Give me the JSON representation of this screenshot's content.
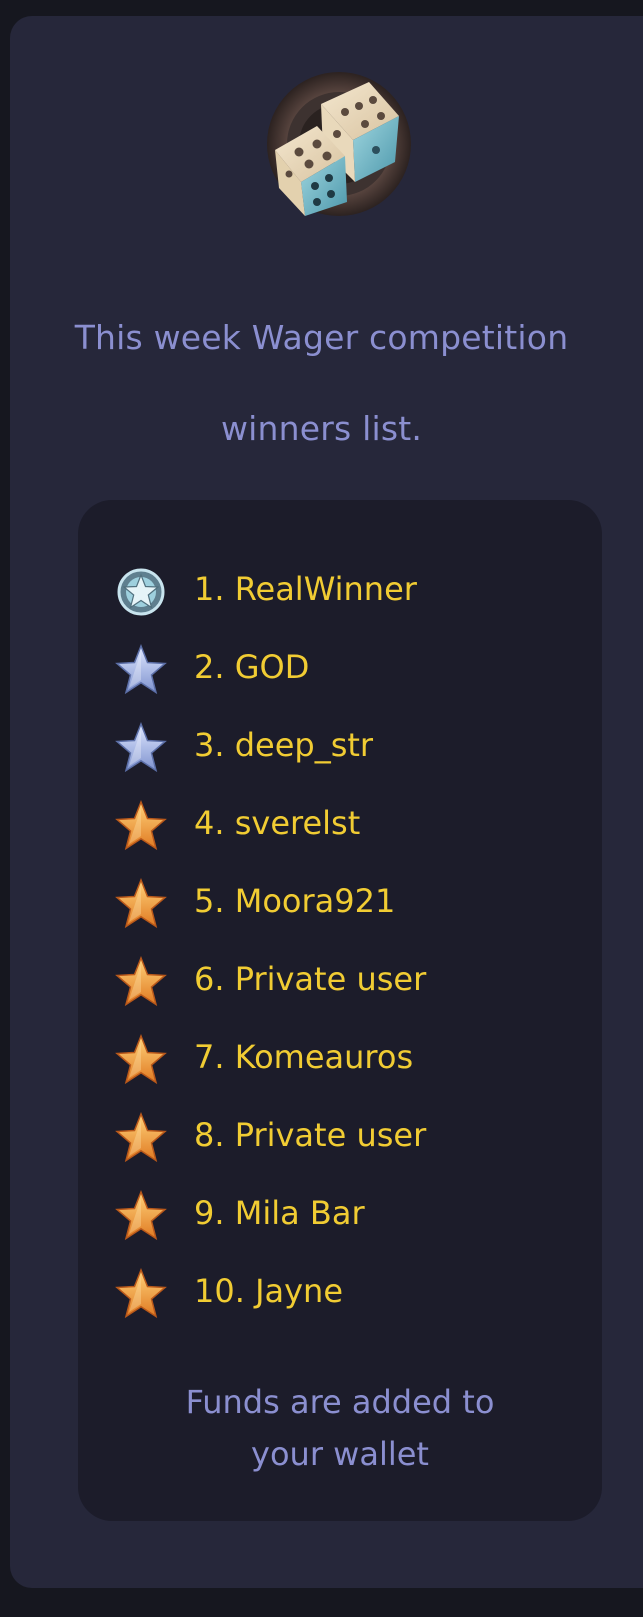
{
  "header": {
    "logo_icon": "dice-icon",
    "title_line1": "This week Wager competition",
    "title_line2": "winners list."
  },
  "winners": [
    {
      "label": "1. RealWinner",
      "icon": "platinum-star-badge-icon"
    },
    {
      "label": "2. GOD",
      "icon": "silver-star-icon"
    },
    {
      "label": "3. deep_str",
      "icon": "silver-star-icon"
    },
    {
      "label": "4. sverelst",
      "icon": "gold-star-icon"
    },
    {
      "label": "5. Moora921",
      "icon": "gold-star-icon"
    },
    {
      "label": "6. Private user",
      "icon": "gold-star-icon"
    },
    {
      "label": "7. Komeauros",
      "icon": "gold-star-icon"
    },
    {
      "label": "8. Private user",
      "icon": "gold-star-icon"
    },
    {
      "label": "9. Mila Bar",
      "icon": "gold-star-icon"
    },
    {
      "label": "10. Jayne",
      "icon": "gold-star-icon"
    }
  ],
  "footer": {
    "line1": "Funds are added to",
    "line2": "your wallet"
  },
  "colors": {
    "page_bg": "#16171f",
    "card_bg": "#26273a",
    "panel_bg": "#1c1c2a",
    "heading_text": "#8b8fd0",
    "winner_text": "#f1cc33",
    "gold_star": "#f59a3a",
    "silver_star": "#a9b8e8"
  }
}
